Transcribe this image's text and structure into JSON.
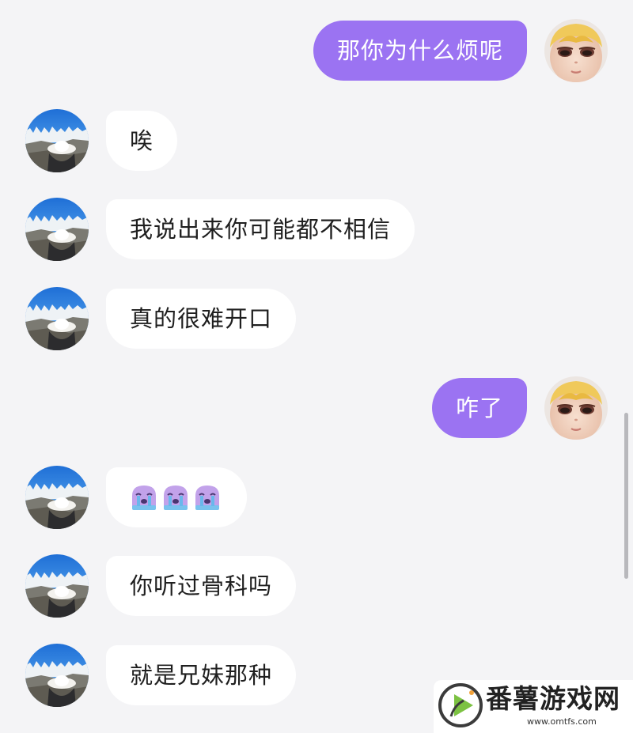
{
  "conversation": {
    "messages": [
      {
        "side": "out",
        "text": "那你为什么烦呢"
      },
      {
        "side": "in",
        "text": "唉"
      },
      {
        "side": "in",
        "text": "我说出来你可能都不相信"
      },
      {
        "side": "in",
        "text": "真的很难开口"
      },
      {
        "side": "out",
        "text": "咋了"
      },
      {
        "side": "in",
        "emoji": [
          "crying-face-icon",
          "crying-face-icon",
          "crying-face-icon"
        ]
      },
      {
        "side": "in",
        "text": "你听过骨科吗"
      },
      {
        "side": "in",
        "text": "就是兄妹那种"
      }
    ]
  },
  "colors": {
    "background": "#f4f4f6",
    "incoming_bubble": "#ffffff",
    "outgoing_bubble": "#9b73f2",
    "incoming_text": "#1f1f1f",
    "outgoing_text": "#ffffff"
  },
  "avatars": {
    "incoming": "hollywood-sign-avatar",
    "outgoing": "doll-face-avatar"
  },
  "watermark": {
    "title": "番薯游戏网",
    "url": "www.omtfs.com",
    "logo": "play-logo-icon"
  }
}
